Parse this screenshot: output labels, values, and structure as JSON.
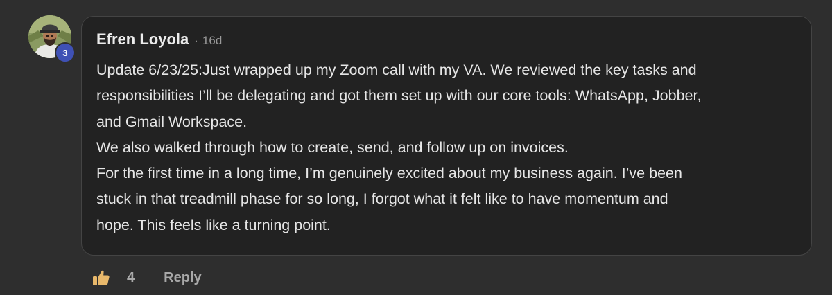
{
  "comment": {
    "author": "Efren Loyola",
    "separator": "·",
    "time_ago": "16d",
    "level_badge": "3",
    "body_lines": [
      "Update 6/23/25:Just wrapped up my Zoom call with my VA. We reviewed the key tasks and",
      "responsibilities I’ll be delegating and got them set up with our core tools: WhatsApp, Jobber,",
      "and Gmail Workspace.",
      "We also walked through how to create, send, and follow up on invoices.",
      "For the first time in a long time, I’m genuinely excited about my business again. I’ve been",
      "stuck in that treadmill phase for so long, I forgot what it felt like to have momentum and",
      "hope. This feels like a turning point."
    ]
  },
  "actions": {
    "like_icon": "thumbs-up-icon",
    "like_count": "4",
    "reply_label": "Reply"
  },
  "colors": {
    "background": "#2e2e2e",
    "bubble": "#222222",
    "badge": "#3f51b5",
    "like_icon": "#e8b86b",
    "text": "#e6e6e6",
    "muted": "#a8a8a8"
  }
}
